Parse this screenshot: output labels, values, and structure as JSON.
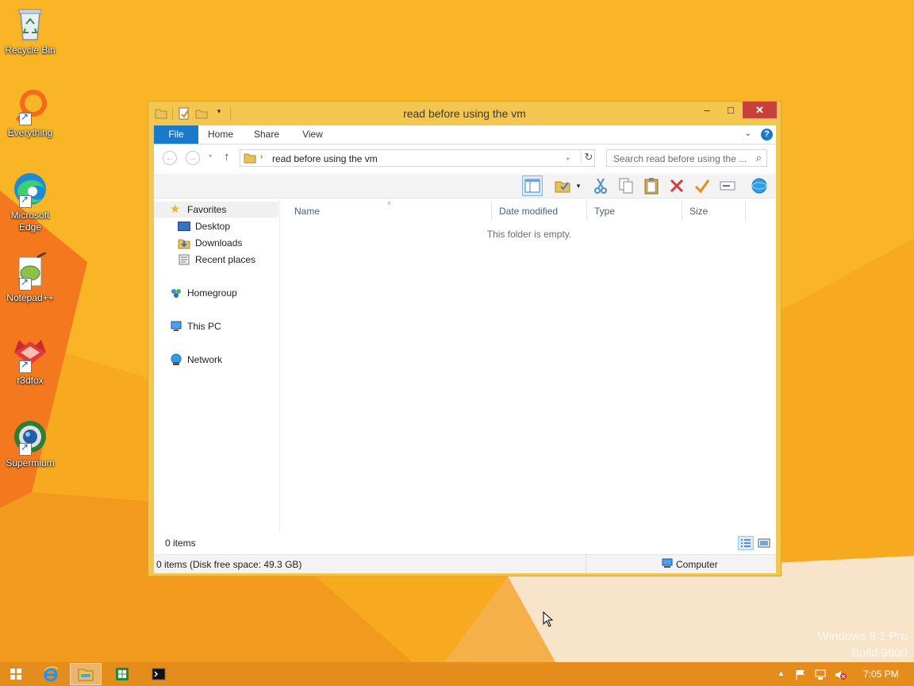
{
  "desktop": {
    "icons": [
      {
        "label": "Recycle Bin",
        "icon": "recycle-bin-icon"
      },
      {
        "label": "Everything",
        "icon": "everything-search-icon"
      },
      {
        "label": "Microsoft Edge",
        "icon": "edge-icon"
      },
      {
        "label": "Notepad++",
        "icon": "notepad-plus-plus-icon"
      },
      {
        "label": "r3dfox",
        "icon": "r3dfox-icon"
      },
      {
        "label": "Supermium",
        "icon": "supermium-icon"
      }
    ],
    "watermark": {
      "line1": "Windows 8.1 Pro",
      "line2": "Build 9600"
    }
  },
  "window": {
    "title": "read before using the vm",
    "controls": {
      "minimize": "–",
      "maximize": "□",
      "close": "✕"
    },
    "ribbon_tabs": {
      "file": "File",
      "home": "Home",
      "share": "Share",
      "view": "View"
    },
    "address": {
      "path": "read before using the vm"
    },
    "search": {
      "placeholder": "Search read before using the ..."
    },
    "nav": {
      "favorites": "Favorites",
      "desktop": "Desktop",
      "downloads": "Downloads",
      "recent": "Recent places",
      "homegroup": "Homegroup",
      "thispc": "This PC",
      "network": "Network"
    },
    "columns": {
      "name": "Name",
      "date": "Date modified",
      "type": "Type",
      "size": "Size"
    },
    "empty_message": "This folder is empty.",
    "items_count": "0 items",
    "status": {
      "left": "0 items (Disk free space: 49.3 GB)",
      "right": "Computer"
    }
  },
  "taskbar": {
    "time": "7:05 PM"
  },
  "colors": {
    "accent": "#1979ca",
    "window_frame": "#f3c64f",
    "close": "#c7403a",
    "desktop": "#f5a623"
  }
}
